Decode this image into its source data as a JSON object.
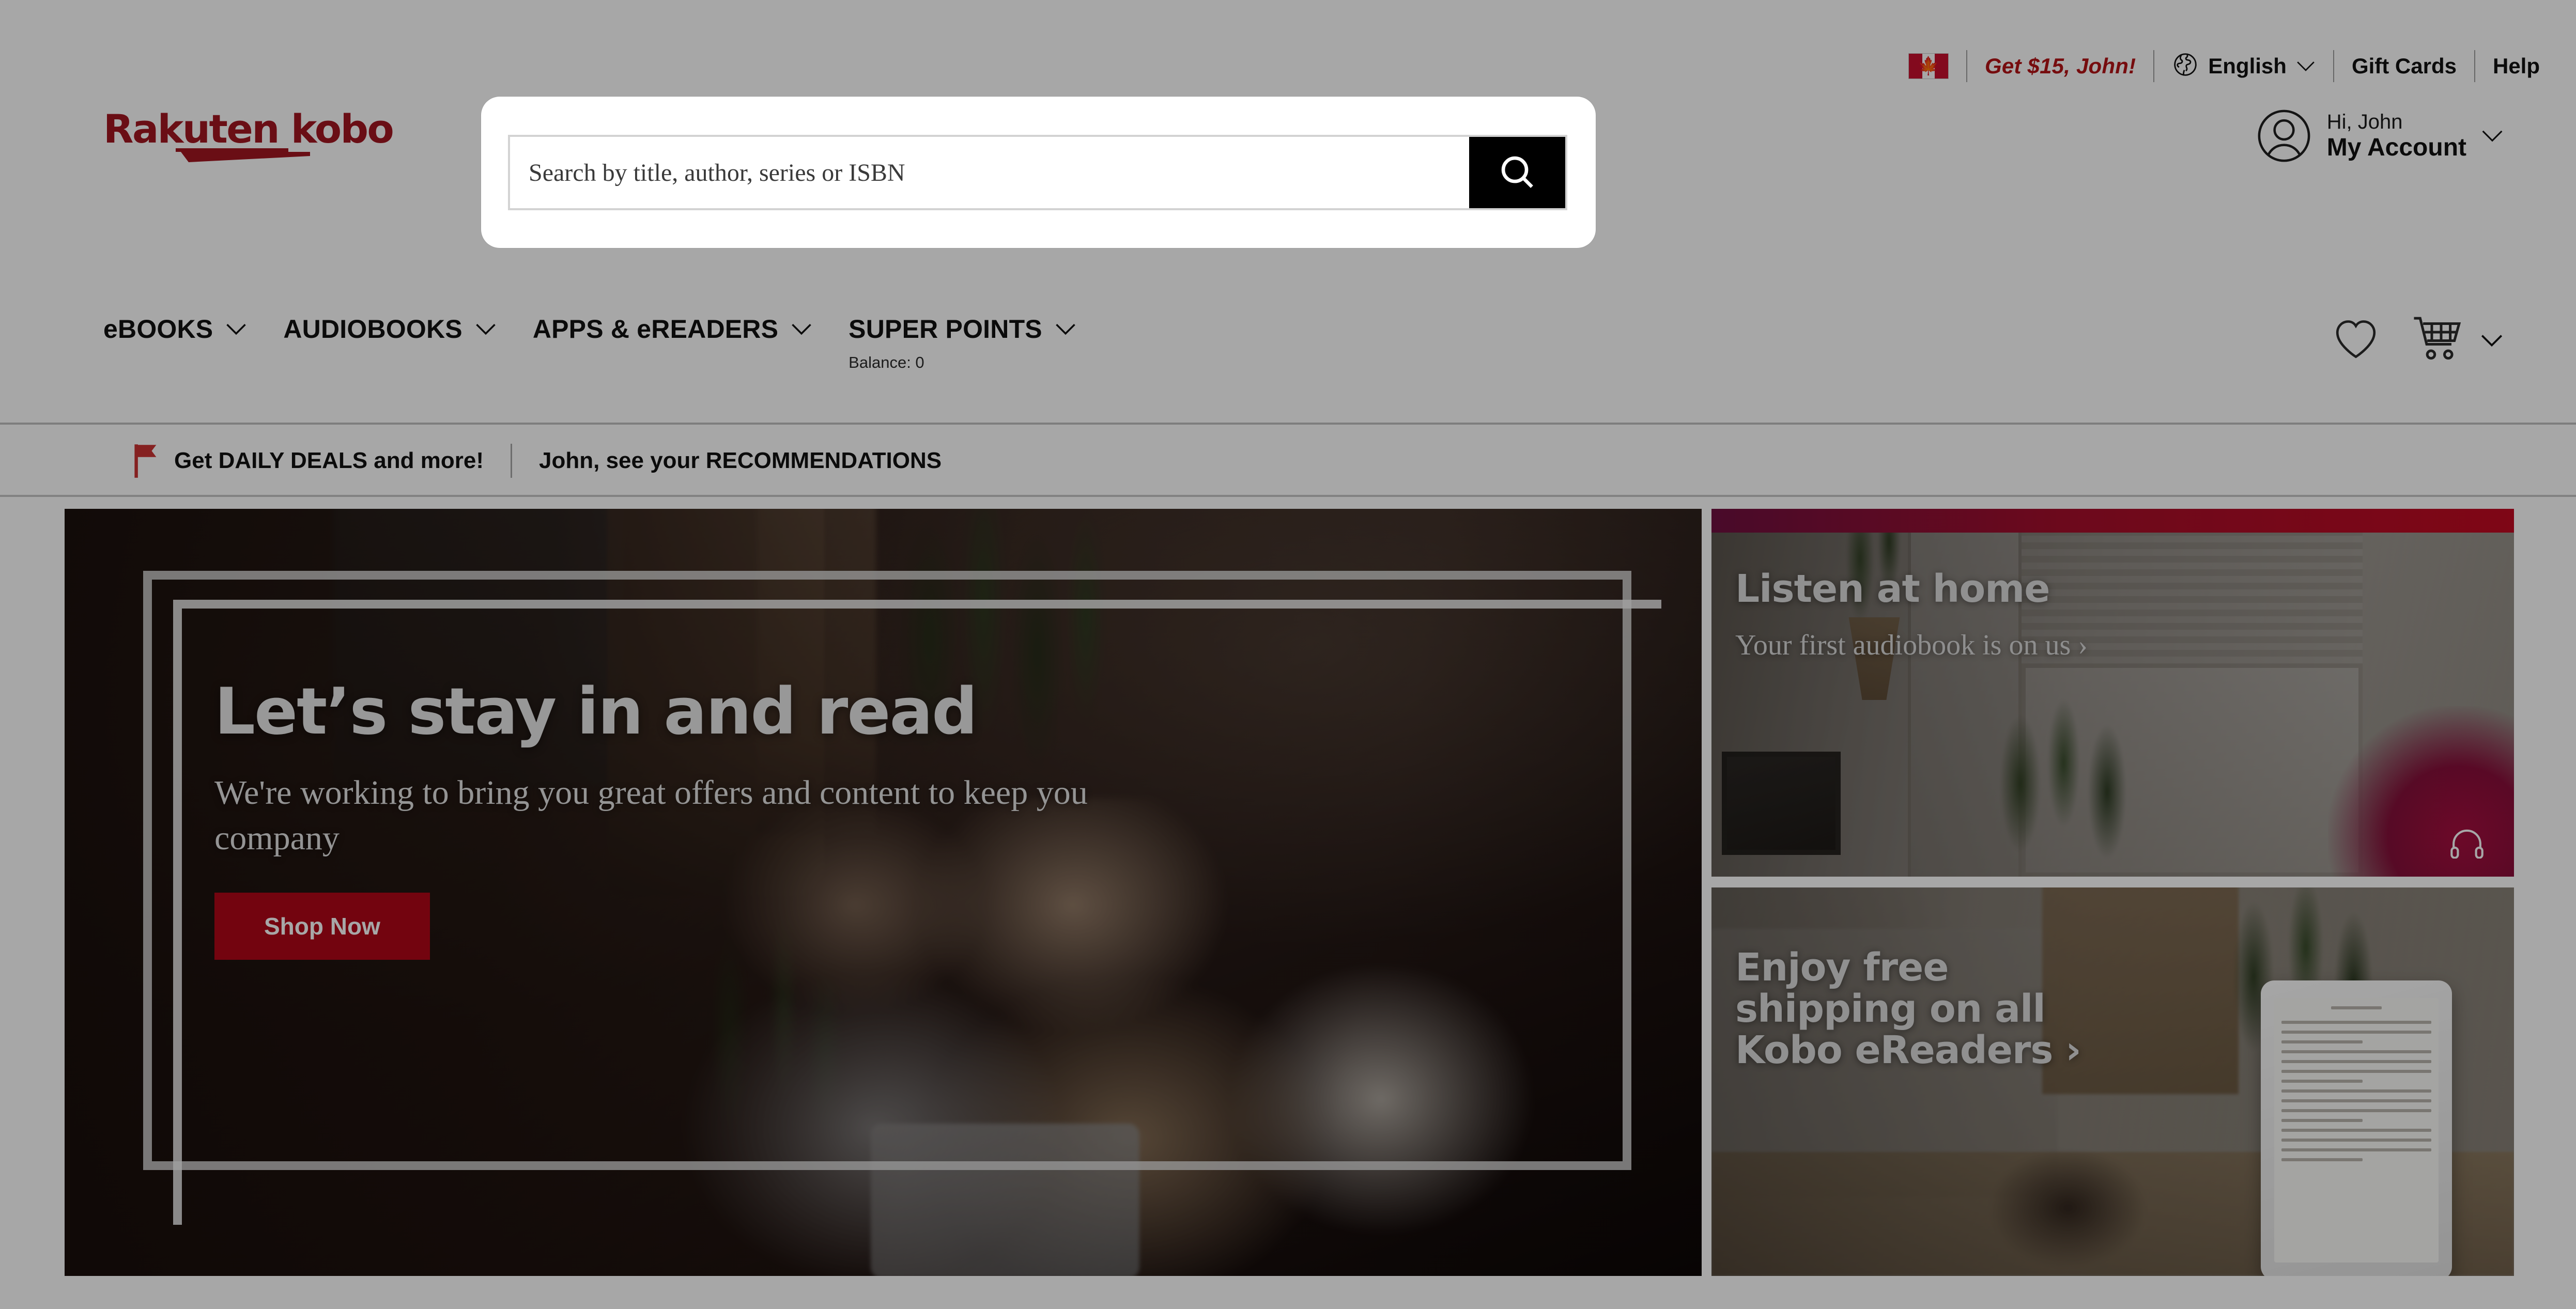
{
  "brand": {
    "name": "Rakuten kobo",
    "accent_red": "#a31621",
    "cta_red": "#b00718"
  },
  "utility_bar": {
    "flag": "canada-flag",
    "promo_text": "Get $15, John!",
    "language": {
      "icon": "globe-icon",
      "label": "English",
      "chevron": "chevron-down-icon"
    },
    "links": [
      {
        "label": "Gift Cards"
      },
      {
        "label": "Help"
      }
    ]
  },
  "search": {
    "placeholder": "Search by title, author, series or ISBN",
    "value": "",
    "button_icon": "search-icon"
  },
  "account": {
    "avatar_icon": "user-avatar-icon",
    "greeting": "Hi, John",
    "label": "My Account",
    "chevron": "chevron-down-icon"
  },
  "main_nav": {
    "items": [
      {
        "label": "eBOOKS",
        "chevron": "chevron-down-icon",
        "sublabel": ""
      },
      {
        "label": "AUDIOBOOKS",
        "chevron": "chevron-down-icon",
        "sublabel": ""
      },
      {
        "label": "APPS & eREADERS",
        "chevron": "chevron-down-icon",
        "sublabel": ""
      },
      {
        "label": "SUPER POINTS",
        "chevron": "chevron-down-icon",
        "sublabel": "Balance: 0"
      }
    ],
    "wishlist_icon": "heart-icon",
    "cart_icon": "shopping-cart-icon",
    "cart_chevron": "chevron-down-icon"
  },
  "promo_strip": {
    "flag_icon": "red-flag-icon",
    "deals_link": "Get DAILY DEALS and more!",
    "recommendations_link": "John, see your RECOMMENDATIONS"
  },
  "hero": {
    "headline": "Let’s stay in and read",
    "subline": "We're working to bring you great offers and content to keep you company",
    "cta_label": "Shop Now"
  },
  "promo_cards": [
    {
      "headline": "Listen at home",
      "subline": "Your first audiobook is on us ›",
      "icon": "headphones-icon",
      "accent_color": "#c20a22"
    },
    {
      "headline_line1": "Enjoy free",
      "headline_line2": "shipping on all",
      "headline_line3": "Kobo eReaders ›"
    }
  ]
}
